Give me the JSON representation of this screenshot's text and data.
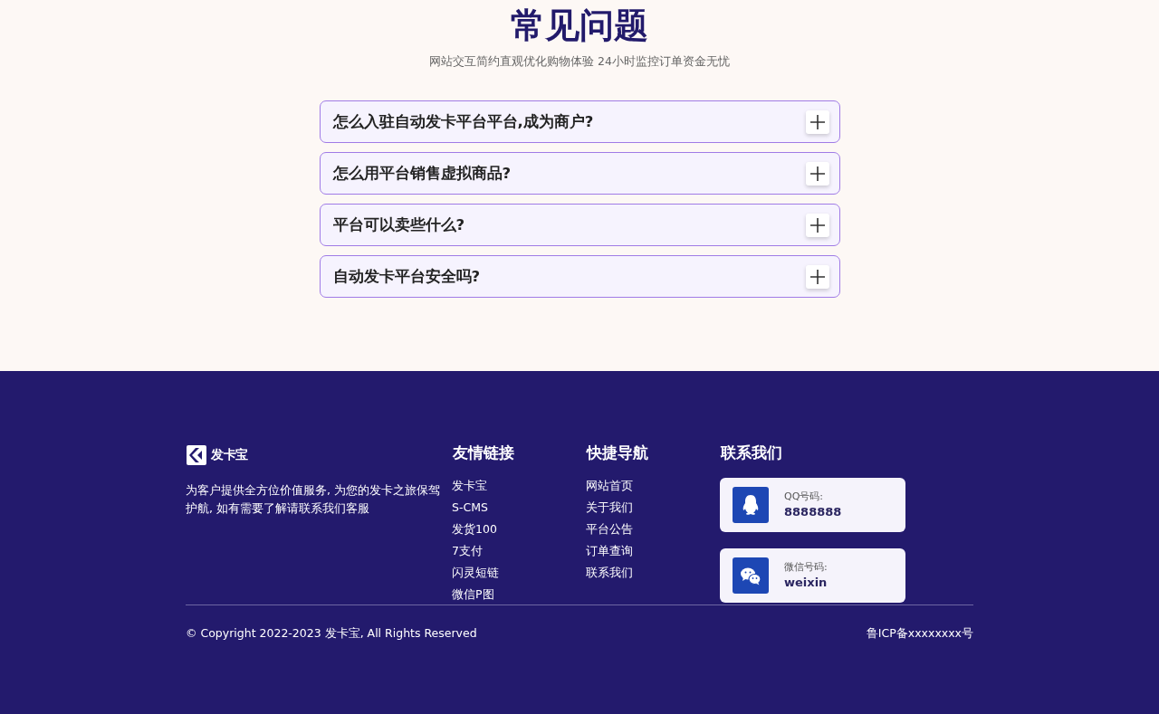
{
  "faq": {
    "title": "常见问题",
    "subtitle": "网站交互简约直观优化购物体验 24小时监控订单资金无忧",
    "items": [
      {
        "question": "怎么入驻自动发卡平台平台,成为商户?",
        "expanded": false
      },
      {
        "question": "怎么用平台销售虚拟商品?",
        "expanded": false
      },
      {
        "question": "平台可以卖些什么?",
        "expanded": false
      },
      {
        "question": "自动发卡平台安全吗?",
        "expanded": false
      }
    ]
  },
  "footer": {
    "brand": {
      "name": "发卡宝",
      "description": "为客户提供全方位价值服务, 为您的发卡之旅保驾护航, 如有需要了解请联系我们客服"
    },
    "columns": [
      {
        "heading": "友情链接",
        "links": [
          "发卡宝",
          "S-CMS",
          "发货100",
          "7支付",
          "闪灵短链",
          "微信P图"
        ]
      },
      {
        "heading": "快捷导航",
        "links": [
          "网站首页",
          "关于我们",
          "平台公告",
          "订单查询",
          "联系我们"
        ]
      }
    ],
    "contact": {
      "heading": "联系我们",
      "cards": [
        {
          "kind": "qq",
          "label": "QQ号码:",
          "value": "8888888"
        },
        {
          "kind": "wechat",
          "label": "微信号码:",
          "value": "weixin"
        }
      ]
    },
    "copyright": "© Copyright 2022-2023 发卡宝, All Rights Reserved",
    "icp": "鲁ICP备xxxxxxxx号"
  }
}
